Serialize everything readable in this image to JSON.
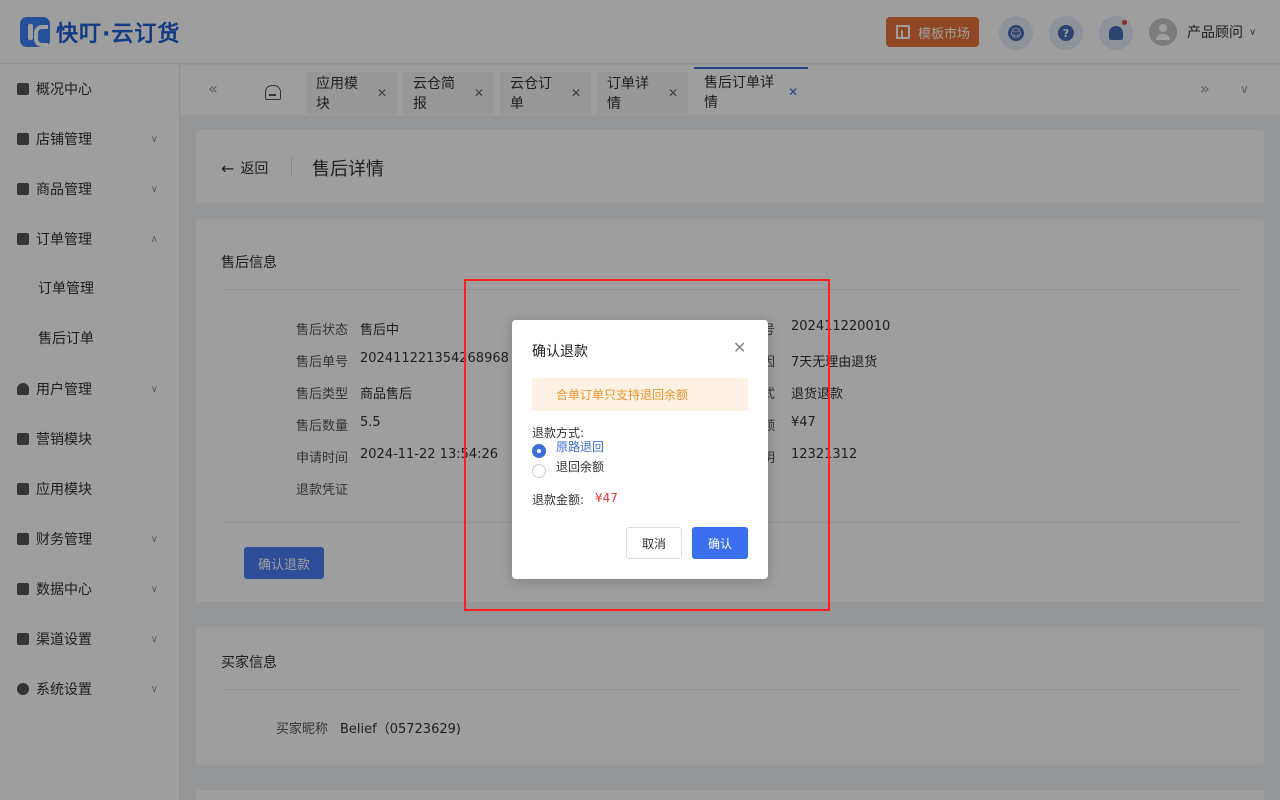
{
  "header": {
    "logo_text": "快叮·云订货",
    "market_label": "模板市场",
    "user_name": "产品顾问",
    "icons": [
      "customer-service-icon",
      "help-icon",
      "bell-icon"
    ]
  },
  "sidebar": {
    "items": [
      {
        "label": "概况中心",
        "icon": "bag-icon"
      },
      {
        "label": "店铺管理",
        "icon": "store-icon"
      },
      {
        "label": "商品管理",
        "icon": "box-icon"
      },
      {
        "label": "订单管理",
        "icon": "clipboard-icon"
      },
      {
        "label": "订单管理"
      },
      {
        "label": "售后订单"
      },
      {
        "label": "用户管理",
        "icon": "user-icon"
      },
      {
        "label": "营销模块",
        "icon": "chart-icon"
      },
      {
        "label": "应用模块",
        "icon": "grid-icon"
      },
      {
        "label": "财务管理",
        "icon": "wallet-icon"
      },
      {
        "label": "数据中心",
        "icon": "bar-chart-icon"
      },
      {
        "label": "渠道设置",
        "icon": "list-icon"
      },
      {
        "label": "系统设置",
        "icon": "gear-icon"
      }
    ]
  },
  "tabs": {
    "items": [
      "应用模块",
      "云仓简报",
      "云仓订单",
      "订单详情",
      "售后订单详情"
    ]
  },
  "page": {
    "back_label": "返回",
    "title": "售后详情",
    "section_after_sale": "售后信息",
    "section_buyer": "买家信息",
    "confirm_refund_btn": "确认退款"
  },
  "fields_left": [
    {
      "label": "售后状态",
      "value": "售后中"
    },
    {
      "label": "售后单号",
      "value": "2024112213542689​68"
    },
    {
      "label": "售后类型",
      "value": "商品售后"
    },
    {
      "label": "售后数量",
      "value": "5.5"
    },
    {
      "label": "申请时间",
      "value": "2024-11-22 13:54:26"
    },
    {
      "label": "退款凭证",
      "value": ""
    }
  ],
  "fields_right": [
    {
      "label": "号",
      "value": "202411220010"
    },
    {
      "label": "因",
      "value": "7天无理由退货"
    },
    {
      "label": "式",
      "value": "退货退款"
    },
    {
      "label": "额",
      "value": "¥47"
    },
    {
      "label": "明",
      "value": "12321312"
    }
  ],
  "buyer": {
    "label": "买家昵称",
    "value": "Belief（05723629)"
  },
  "dialog": {
    "title": "确认退款",
    "warning": "合单订单只支持退回余额",
    "method_label": "退款方式:",
    "option_original": "原路退回",
    "option_balance": "退回余额",
    "selected": "原路退回",
    "amount_label": "退款金额:",
    "amount_value": "¥47",
    "cancel_label": "取消",
    "ok_label": "确认"
  },
  "colors": {
    "accent": "#3b6fd6",
    "market": "#e8743b",
    "warning_text": "#e6962e",
    "amount": "#e53935",
    "highlight_box": "#ff1f1f"
  }
}
